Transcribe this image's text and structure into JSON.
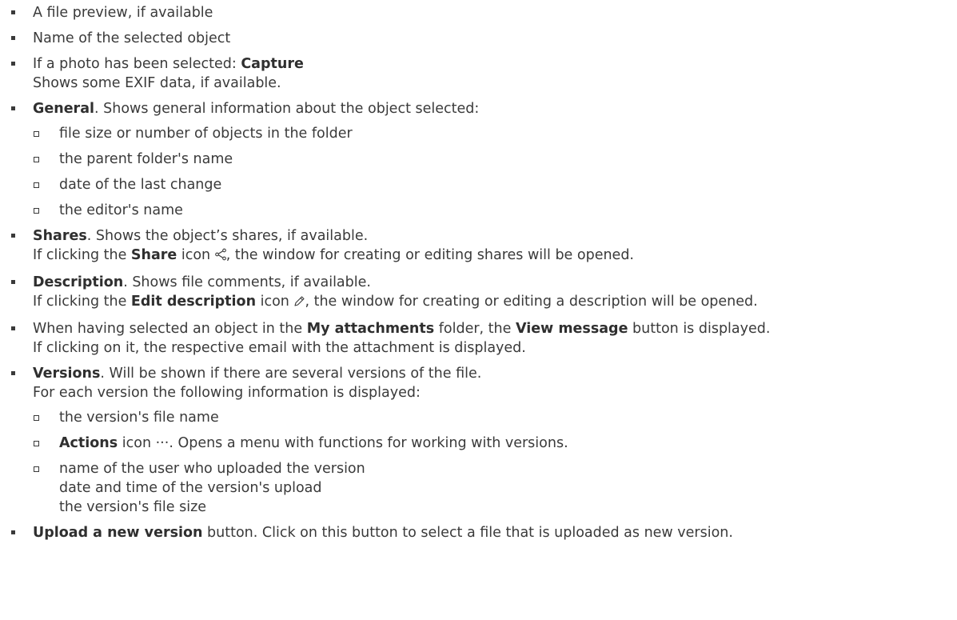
{
  "items": {
    "preview": "A file preview, if available",
    "name": "Name of the selected object",
    "photo": {
      "pre": "If a photo has been selected: ",
      "bold": "Capture",
      "line2": "Shows some EXIF data, if available."
    },
    "general": {
      "bold": "General",
      "text": ". Shows general information about the object selected:",
      "sub": [
        "file size or number of objects in the folder",
        "the parent folder's name",
        "date of the last change",
        "the editor's name"
      ]
    },
    "shares": {
      "bold": "Shares",
      "text": ". Shows the object’s shares, if available.",
      "l2_pre": "If clicking the ",
      "l2_bold": "Share",
      "l2_mid": " icon ",
      "l2_post": ", the window for creating or editing shares will be opened.",
      "icon": "share-icon"
    },
    "description": {
      "bold": "Description",
      "text": ". Shows file comments, if available.",
      "l2_pre": "If clicking the ",
      "l2_bold": "Edit description",
      "l2_mid": " icon ",
      "l2_post": ", the window for creating or editing a description will be opened.",
      "icon": "pencil-icon"
    },
    "attachments": {
      "pre": "When having selected an object in the ",
      "bold1": "My attachments",
      "mid": " folder, the ",
      "bold2": "View message",
      "post": " button is displayed.",
      "line2": "If clicking on it, the respective email with the attachment is displayed."
    },
    "versions": {
      "bold": "Versions",
      "text": ". Will be shown if there are several versions of the file.",
      "line2": "For each version the following information is displayed:",
      "sub1": "the version's file name",
      "actions_bold": "Actions",
      "actions_mid": " icon ",
      "actions_glyph": "···",
      "actions_text": ". Opens a menu with functions for working with versions.",
      "sub3": [
        "name of the user who uploaded the version",
        "date and time of the version's upload",
        "the version's file size"
      ]
    },
    "upload": {
      "bold": "Upload a new version",
      "text": " button. Click on this button to select a file that is uploaded as new version."
    }
  }
}
